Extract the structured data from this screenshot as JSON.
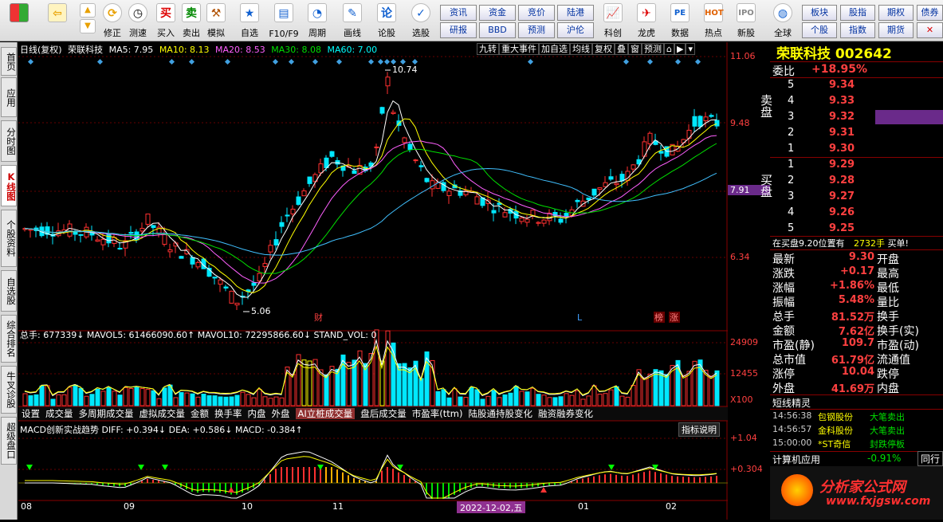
{
  "toolbar": {
    "items": [
      {
        "label": "",
        "icon": "grid-icon"
      },
      {
        "label": "",
        "icon": "back-arrow-icon"
      },
      {
        "label": "修正",
        "icon": "revise-icon"
      },
      {
        "label": "测速",
        "icon": "clock-icon"
      },
      {
        "label": "买入",
        "icon": "buy-icon"
      },
      {
        "label": "卖出",
        "icon": "sell-icon"
      },
      {
        "label": "模拟",
        "icon": "hammer-icon"
      },
      {
        "label": "自选",
        "icon": "star-icon"
      },
      {
        "label": "F10/F9",
        "icon": "f10-icon"
      },
      {
        "label": "周期",
        "icon": "period-icon"
      },
      {
        "label": "画线",
        "icon": "pencil-icon"
      },
      {
        "label": "论股",
        "icon": "discuss-icon"
      },
      {
        "label": "选股",
        "icon": "select-stock-icon"
      },
      {
        "label": "科创",
        "icon": "kechuang-icon"
      },
      {
        "label": "龙虎",
        "icon": "dragon-tiger-icon"
      },
      {
        "label": "数据",
        "icon": "pe-icon"
      },
      {
        "label": "热点",
        "icon": "hot-icon"
      },
      {
        "label": "新股",
        "icon": "ipo-icon"
      },
      {
        "label": "全球",
        "icon": "globe-icon"
      }
    ],
    "small_buttons": [
      "资讯",
      "资金",
      "竞价",
      "陆港",
      "研报",
      "BBD",
      "预测",
      "沪伦",
      "板块",
      "股指",
      "期权",
      "债券",
      "个股",
      "指数",
      "期货"
    ]
  },
  "left_nav": [
    "首页",
    "应用",
    "分时图",
    "K线图",
    "个股资料",
    "自选股",
    "综合排名",
    "牛叉诊股",
    "超级盘口"
  ],
  "price_chart": {
    "header": {
      "name": "日线(复权)",
      "stock": "荣联科技",
      "ma5": "MA5: 7.95",
      "ma10": "MA10: 8.13",
      "ma20": "MA20: 8.53",
      "ma30": "MA30: 8.08",
      "ma60": "MA60: 7.00"
    },
    "buttons": [
      "九转",
      "重大事件",
      "加自选",
      "均线",
      "复权",
      "叠",
      "窗",
      "预测"
    ],
    "high_label": "10.74",
    "low_label": "5.06",
    "axis_ticks": [
      "11.06",
      "9.48",
      "7.91",
      "6.34"
    ],
    "event_labels": [
      "财",
      "L",
      "榜",
      "涨"
    ]
  },
  "volume_chart": {
    "header": "总手: 677339↓ MAVOL5: 61466090.60↑ MAVOL10: 72295866.60↓ STAND_VOL: 0",
    "axis_ticks": [
      "24909",
      "12455",
      "X100"
    ]
  },
  "indicator_tabs": [
    "设置",
    "成交量",
    "多周期成交量",
    "虚拟成交量",
    "金额",
    "换手率",
    "内盘",
    "外盘",
    "AI立桩成交量",
    "盘后成交量",
    "市盈率(ttm)",
    "陆股通持股变化",
    "融资融券变化"
  ],
  "macd": {
    "header": "MACD创新实战趋势 DIFF: +0.394↓ DEA: +0.586↓ MACD: -0.384↑",
    "explain": "指标说明",
    "axis_ticks": [
      "+1.04",
      "+0.304"
    ]
  },
  "x_axis": [
    "08",
    "09",
    "10",
    "11",
    "2022-12-02,五",
    "01",
    "02"
  ],
  "quote": {
    "title": "荣联科技 002642",
    "ratio_label": "委比",
    "ratio": "+18.95%",
    "sell_label": "卖盘",
    "buy_label": "买盘",
    "sell": [
      {
        "n": "5",
        "p": "9.34"
      },
      {
        "n": "4",
        "p": "9.33"
      },
      {
        "n": "3",
        "p": "9.32"
      },
      {
        "n": "2",
        "p": "9.31"
      },
      {
        "n": "1",
        "p": "9.30"
      }
    ],
    "buy": [
      {
        "n": "1",
        "p": "9.29"
      },
      {
        "n": "2",
        "p": "9.28"
      },
      {
        "n": "3",
        "p": "9.27"
      },
      {
        "n": "4",
        "p": "9.26"
      },
      {
        "n": "5",
        "p": "9.25"
      }
    ],
    "notice": "在买盘9.20位置有",
    "notice_qty": "2732手",
    "notice_tail": "买单!",
    "stats": [
      {
        "l": "最新",
        "v": "9.30",
        "r": "开盘"
      },
      {
        "l": "涨跌",
        "v": "+0.17",
        "r": "最高"
      },
      {
        "l": "涨幅",
        "v": "+1.86%",
        "r": "最低"
      },
      {
        "l": "振幅",
        "v": "5.48%",
        "r": "量比"
      },
      {
        "l": "总手",
        "v": "81.52万",
        "r": "换手"
      },
      {
        "l": "金额",
        "v": "7.62亿",
        "r": "换手(实)"
      },
      {
        "l": "市盈(静)",
        "v": "109.7",
        "r": "市盈(动)"
      },
      {
        "l": "总市值",
        "v": "61.79亿",
        "r": "流通值"
      },
      {
        "l": "涨停",
        "v": "10.04",
        "r": "跌停"
      },
      {
        "l": "外盘",
        "v": "41.69万",
        "r": "内盘"
      }
    ],
    "elf_title": "短线精灵",
    "elf": [
      {
        "t": "14:56:38",
        "s": "包钢股份",
        "e": "大笔卖出"
      },
      {
        "t": "14:56:57",
        "s": "金科股份",
        "e": "大笔卖出"
      },
      {
        "t": "15:00:00",
        "s": "*ST奇信",
        "e": "封跌停板"
      }
    ],
    "sector": "计算机应用",
    "sector_chg": "-0.91%",
    "sector_btn": "同行",
    "watermark": "分析家公式网",
    "watermark_url": "www.fxjgsw.com"
  }
}
